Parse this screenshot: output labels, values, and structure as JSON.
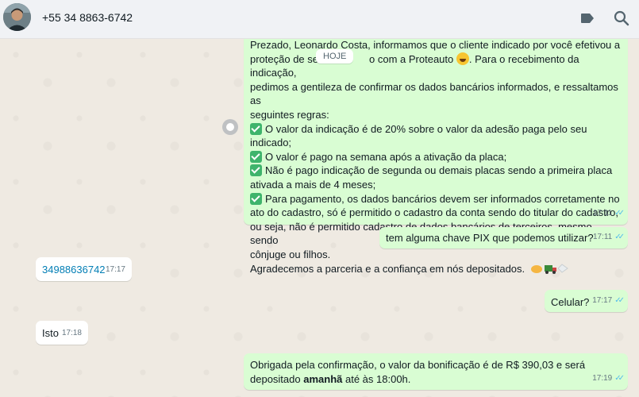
{
  "header": {
    "contact_name": "+55 34 8863-6742",
    "icons": [
      "avatar",
      "tag-icon",
      "search-icon"
    ]
  },
  "date_chip": "HOJE",
  "messages": [
    {
      "direction": "out",
      "lines": [
        "Prezado, Leonardo Costa, informamos que o cliente indicado por você efetivou a",
        "proteção de se",
        "o com a Proteauto",
        ". Para o recebimento da indicação,",
        "pedimos a gentileza de confirmar os dados bancários informados, e  ressaltamos as",
        "seguintes regras:",
        "O valor da indicação é de 20% sobre o valor da adesão paga pelo seu indicado;",
        "O valor é pago na semana após a ativação da placa;",
        "Não é pago indicação de segunda ou demais placas sendo a primeira placa",
        "ativada a mais de 4 meses;",
        "Para pagamento, os dados bancários devem ser informados corretamente no",
        "ato do cadastro, só é permitido o cadastro da conta sendo do titular do cadastro,",
        "ou seja, não é permitido cadastro de dados bancários de terceiros, mesmo sendo",
        "cônjuge ou filhos.",
        "Agradecemos a parceria e a confiança em nós depositados."
      ],
      "time": "17:11"
    },
    {
      "direction": "out",
      "text": "tem alguma chave PIX que podemos utilizar?",
      "time": "17:11"
    },
    {
      "direction": "in",
      "text": "34988636742",
      "time": "17:17"
    },
    {
      "direction": "out",
      "text": "Celular?",
      "time": "17:17"
    },
    {
      "direction": "in",
      "text": "Isto",
      "time": "17:18"
    },
    {
      "direction": "out",
      "line1": "Obrigada pela confirmação, o valor da bonificação é de R$ 390,03 e será",
      "line2_pre": "depositado ",
      "line2_bold": "amanhã",
      "line2_post": " até às 18:00h.",
      "time": "17:19"
    }
  ],
  "colors": {
    "chat_bg": "#efeae2",
    "outgoing_bubble": "#d9fdd3",
    "incoming_bubble": "#ffffff",
    "read_ticks": "#53bdeb",
    "link": "#027eb5"
  }
}
